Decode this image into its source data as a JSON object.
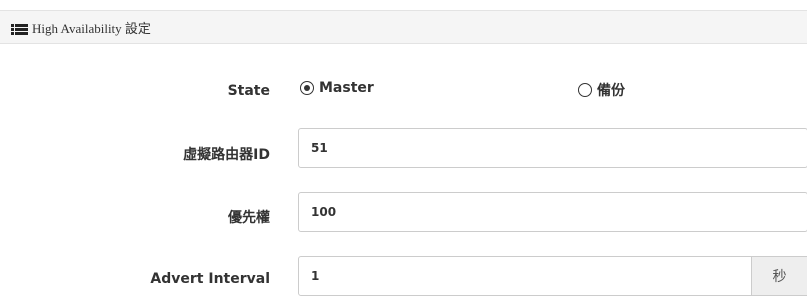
{
  "header": {
    "icon": "list-icon",
    "title": "High Availability 設定"
  },
  "form": {
    "state": {
      "label": "State",
      "options": [
        {
          "label": "Master",
          "checked": true
        },
        {
          "label": "備份",
          "checked": false
        }
      ]
    },
    "vrid": {
      "label": "虛擬路由器ID",
      "value": "51"
    },
    "priority": {
      "label": "優先權",
      "value": "100"
    },
    "advert_interval": {
      "label": "Advert Interval",
      "value": "1",
      "unit": "秒"
    }
  }
}
